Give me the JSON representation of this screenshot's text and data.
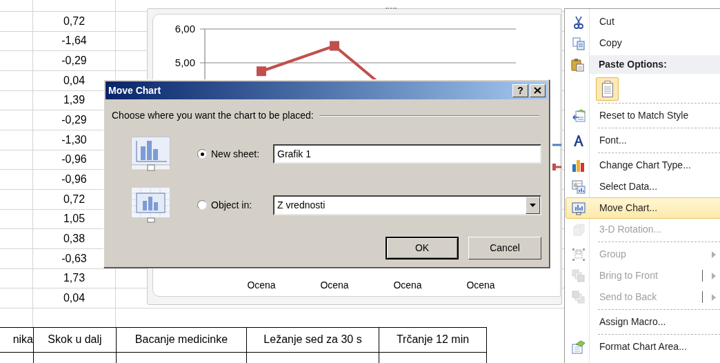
{
  "sheet": {
    "column_b": [
      "0,72",
      "-1,64",
      "-0,29",
      "0,04",
      "1,39",
      "-0,29",
      "-1,30",
      "-0,96",
      "-0,96",
      "0,72",
      "1,05",
      "0,38",
      "-0,63",
      "1,73",
      "0,04"
    ]
  },
  "table": {
    "columns": [
      "nika",
      "Skok u dalj",
      "Bacanje medicinke",
      "Ležanje sed za 30 s",
      "Trčanje 12 min"
    ]
  },
  "chart": {
    "y_axis_labels": [
      "6,00",
      "5,00"
    ],
    "category_labels": [
      "Ocena",
      "Ocena",
      "Ocena",
      "Ocena"
    ],
    "legend": [
      {
        "color": "#4f81bd",
        "marker": false
      },
      {
        "color": "#c0504d",
        "marker": true
      }
    ]
  },
  "dialog": {
    "title": "Move Chart",
    "help_button": "?",
    "prompt": "Choose where you want the chart to be placed:",
    "options": [
      {
        "label": "New sheet:",
        "selected": true,
        "field": {
          "kind": "text",
          "value": "Grafik 1"
        }
      },
      {
        "label": "Object in:",
        "selected": false,
        "field": {
          "kind": "dropdown",
          "value": "Z vrednosti"
        }
      }
    ],
    "buttons": [
      {
        "label": "OK",
        "default": true
      },
      {
        "label": "Cancel",
        "default": false
      }
    ]
  },
  "context_menu": [
    {
      "kind": "item",
      "label": "Cut",
      "disabled": false,
      "selected": false,
      "submenu": false,
      "split": false,
      "divider_above": false
    },
    {
      "kind": "item",
      "label": "Copy",
      "disabled": false,
      "selected": false,
      "submenu": false,
      "split": false,
      "divider_above": false
    },
    {
      "kind": "header",
      "label": "Paste Options:"
    },
    {
      "kind": "paste"
    },
    {
      "kind": "item",
      "label": "Reset to Match Style",
      "disabled": false,
      "selected": false,
      "submenu": false,
      "split": false,
      "divider_above": true
    },
    {
      "kind": "item",
      "label": "Font...",
      "disabled": false,
      "selected": false,
      "submenu": false,
      "split": false,
      "divider_above": true
    },
    {
      "kind": "item",
      "label": "Change Chart Type...",
      "disabled": false,
      "selected": false,
      "submenu": false,
      "split": false,
      "divider_above": true
    },
    {
      "kind": "item",
      "label": "Select Data...",
      "disabled": false,
      "selected": false,
      "submenu": false,
      "split": false,
      "divider_above": false
    },
    {
      "kind": "item",
      "label": "Move Chart...",
      "disabled": false,
      "selected": true,
      "submenu": false,
      "split": false,
      "divider_above": false
    },
    {
      "kind": "item",
      "label": "3-D Rotation...",
      "disabled": true,
      "selected": false,
      "submenu": false,
      "split": false,
      "divider_above": false
    },
    {
      "kind": "item",
      "label": "Group",
      "disabled": true,
      "selected": false,
      "submenu": true,
      "split": false,
      "divider_above": true
    },
    {
      "kind": "item",
      "label": "Bring to Front",
      "disabled": true,
      "selected": false,
      "submenu": true,
      "split": true,
      "divider_above": false
    },
    {
      "kind": "item",
      "label": "Send to Back",
      "disabled": true,
      "selected": false,
      "submenu": true,
      "split": true,
      "divider_above": false
    },
    {
      "kind": "item",
      "label": "Assign Macro...",
      "disabled": false,
      "selected": false,
      "submenu": false,
      "split": false,
      "divider_above": true
    },
    {
      "kind": "item",
      "label": "Format Chart Area...",
      "disabled": false,
      "selected": false,
      "submenu": false,
      "split": false,
      "divider_above": true
    }
  ]
}
